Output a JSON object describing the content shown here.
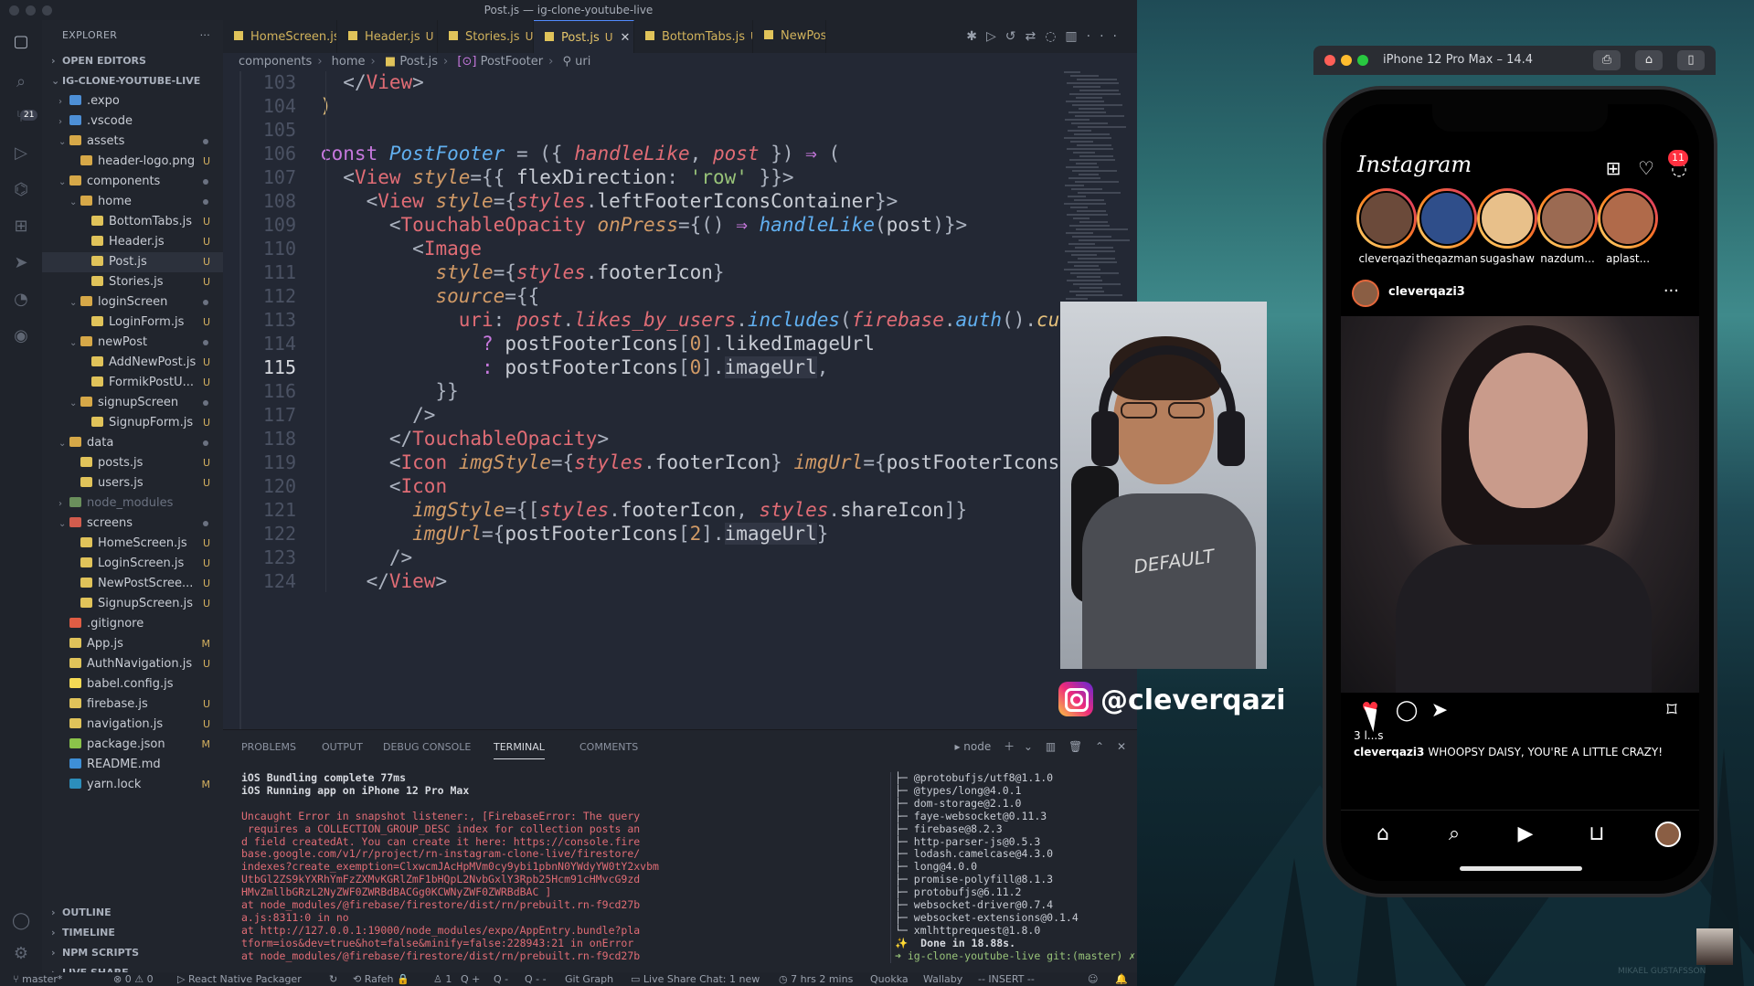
{
  "window": {
    "title": "Post.js — ig-clone-youtube-live"
  },
  "activity_bar": {
    "scm_badge": "21"
  },
  "explorer": {
    "header": "EXPLORER",
    "open_editors": "OPEN EDITORS",
    "project": "IG-CLONE-YOUTUBE-LIVE",
    "items": [
      {
        "label": ".expo",
        "indent": 1,
        "kind": "folder-closed",
        "status": ""
      },
      {
        "label": ".vscode",
        "indent": 1,
        "kind": "folder-closed",
        "status": ""
      },
      {
        "label": "assets",
        "indent": 1,
        "kind": "folder-open",
        "status": "dot"
      },
      {
        "label": "header-logo.png",
        "indent": 2,
        "kind": "file",
        "status": "U"
      },
      {
        "label": "components",
        "indent": 1,
        "kind": "folder-open",
        "status": "dot"
      },
      {
        "label": "home",
        "indent": 2,
        "kind": "folder-open",
        "status": "dot"
      },
      {
        "label": "BottomTabs.js",
        "indent": 3,
        "kind": "js",
        "status": "U"
      },
      {
        "label": "Header.js",
        "indent": 3,
        "kind": "js",
        "status": "U"
      },
      {
        "label": "Post.js",
        "indent": 3,
        "kind": "js",
        "status": "U",
        "selected": true
      },
      {
        "label": "Stories.js",
        "indent": 3,
        "kind": "js",
        "status": "U"
      },
      {
        "label": "loginScreen",
        "indent": 2,
        "kind": "folder-open",
        "status": "dot"
      },
      {
        "label": "LoginForm.js",
        "indent": 3,
        "kind": "js",
        "status": "U"
      },
      {
        "label": "newPost",
        "indent": 2,
        "kind": "folder-open",
        "status": "dot"
      },
      {
        "label": "AddNewPost.js",
        "indent": 3,
        "kind": "js",
        "status": "U"
      },
      {
        "label": "FormikPostU...",
        "indent": 3,
        "kind": "js",
        "status": "U"
      },
      {
        "label": "signupScreen",
        "indent": 2,
        "kind": "folder-open",
        "status": "dot"
      },
      {
        "label": "SignupForm.js",
        "indent": 3,
        "kind": "js",
        "status": "U"
      },
      {
        "label": "data",
        "indent": 1,
        "kind": "folder-open",
        "status": "dot"
      },
      {
        "label": "posts.js",
        "indent": 2,
        "kind": "js",
        "status": "U"
      },
      {
        "label": "users.js",
        "indent": 2,
        "kind": "js",
        "status": "U"
      },
      {
        "label": "node_modules",
        "indent": 1,
        "kind": "folder-muted",
        "status": ""
      },
      {
        "label": "screens",
        "indent": 1,
        "kind": "folder-open-red",
        "status": "dot"
      },
      {
        "label": "HomeScreen.js",
        "indent": 2,
        "kind": "js",
        "status": "U"
      },
      {
        "label": "LoginScreen.js",
        "indent": 2,
        "kind": "js",
        "status": "U"
      },
      {
        "label": "NewPostScree...",
        "indent": 2,
        "kind": "js",
        "status": "U"
      },
      {
        "label": "SignupScreen.js",
        "indent": 2,
        "kind": "js",
        "status": "U"
      },
      {
        "label": ".gitignore",
        "indent": 1,
        "kind": "git",
        "status": ""
      },
      {
        "label": "App.js",
        "indent": 1,
        "kind": "js",
        "status": "M"
      },
      {
        "label": "AuthNavigation.js",
        "indent": 1,
        "kind": "js",
        "status": "U"
      },
      {
        "label": "babel.config.js",
        "indent": 1,
        "kind": "babel",
        "status": ""
      },
      {
        "label": "firebase.js",
        "indent": 1,
        "kind": "js",
        "status": "U"
      },
      {
        "label": "navigation.js",
        "indent": 1,
        "kind": "js",
        "status": "U"
      },
      {
        "label": "package.json",
        "indent": 1,
        "kind": "json",
        "status": "M"
      },
      {
        "label": "README.md",
        "indent": 1,
        "kind": "info",
        "status": ""
      },
      {
        "label": "yarn.lock",
        "indent": 1,
        "kind": "yarn",
        "status": "M"
      }
    ],
    "bottom_sections": [
      "OUTLINE",
      "TIMELINE",
      "NPM SCRIPTS",
      "LIVE SHARE"
    ]
  },
  "tabs": [
    {
      "label": "HomeScreen.js",
      "status": "U"
    },
    {
      "label": "Header.js",
      "status": "U"
    },
    {
      "label": "Stories.js",
      "status": "U"
    },
    {
      "label": "Post.js",
      "status": "U",
      "active": true
    },
    {
      "label": "BottomTabs.js",
      "status": "U"
    },
    {
      "label": "NewPostS",
      "status": ""
    }
  ],
  "breadcrumb": [
    "components",
    "home",
    "Post.js",
    "PostFooter",
    "uri"
  ],
  "editor": {
    "current_line": "115",
    "line_numbers": [
      "103",
      "104",
      "105",
      "106",
      "107",
      "108",
      "109",
      "110",
      "111",
      "112",
      "113",
      "114",
      "115",
      "116",
      "117",
      "118",
      "119",
      "120",
      "121",
      "122",
      "123",
      "124"
    ]
  },
  "panel": {
    "tabs": [
      "PROBLEMS",
      "OUTPUT",
      "DEBUG CONSOLE",
      "TERMINAL",
      "COMMENTS"
    ],
    "active_tab": "TERMINAL",
    "shell": "node",
    "terminal_left": [
      {
        "text": "iOS Bundling complete 77ms",
        "style": "white"
      },
      {
        "text": "iOS Running app on iPhone 12 Pro Max",
        "style": "white"
      },
      {
        "text": "",
        "style": "plain"
      },
      {
        "text": "Uncaught Error in snapshot listener:, [FirebaseError: The query",
        "style": "red"
      },
      {
        "text": " requires a COLLECTION_GROUP_DESC index for collection posts an",
        "style": "red"
      },
      {
        "text": "d field createdAt. You can create it here: https://console.fire",
        "style": "red"
      },
      {
        "text": "base.google.com/v1/r/project/rn-instagram-clone-live/firestore/",
        "style": "red"
      },
      {
        "text": "indexes?create_exemption=ClxwcmJAcHpMVm0cy9ybi1pbnN0YWdyYW0tY2xvbm",
        "style": "red"
      },
      {
        "text": "UtbGl2ZS9kYXRhYmFzZXMvKGRlZmF1bHQpL2NvbGxlY3Rpb25Hcm91cHMvcG9zd",
        "style": "red"
      },
      {
        "text": "HMvZmllbGRzL2NyZWF0ZWRBdBACGg0KCWNyZWF0ZWRBdBAC ]",
        "style": "red"
      },
      {
        "text": "at node_modules/@firebase/firestore/dist/rn/prebuilt.rn-f9cd27b",
        "style": "red"
      },
      {
        "text": "a.js:8311:0 in no",
        "style": "red"
      },
      {
        "text": "at http://127.0.0.1:19000/node_modules/expo/AppEntry.bundle?pla",
        "style": "red"
      },
      {
        "text": "tform=ios&dev=true&hot=false&minify=false:228943:21 in onError",
        "style": "red"
      },
      {
        "text": "at node_modules/@firebase/firestore/dist/rn/prebuilt.rn-f9cd27b",
        "style": "red"
      }
    ],
    "terminal_right": [
      "├─ @protobufjs/utf8@1.1.0",
      "├─ @types/long@4.0.1",
      "├─ dom-storage@2.1.0",
      "├─ faye-websocket@0.11.3",
      "├─ firebase@8.2.3",
      "├─ http-parser-js@0.5.3",
      "├─ lodash.camelcase@4.3.0",
      "├─ long@4.0.0",
      "├─ promise-polyfill@8.1.3",
      "├─ protobufjs@6.11.2",
      "├─ websocket-driver@0.7.4",
      "├─ websocket-extensions@0.1.4",
      "└─ xmlhttprequest@1.8.0",
      "✨  Done in 18.88s."
    ],
    "prompt": "➜ ig-clone-youtube-live git:(master) ✗"
  },
  "statusbar": {
    "branch": "master*",
    "problems": "⊗ 0 ⚠ 0",
    "packager": "React Native Packager",
    "user": "Rafeh",
    "count": "1",
    "q1": "Q +",
    "q2": "Q -",
    "q3": "Q - -",
    "git_graph": "Git Graph",
    "live_share": "Live Share Chat: 1 new",
    "time": "7 hrs 2 mins",
    "quokka": "Quokka",
    "wallaby": "Wallaby",
    "mode": "-- INSERT --"
  },
  "overlay": {
    "handle": "@cleverqazi",
    "shirt_text": "DEFAULT"
  },
  "simulator": {
    "title": "iPhone 12 Pro Max – 14.4",
    "app": {
      "wordmark": "Instagram",
      "unread_badge": "11",
      "stories": [
        {
          "name": "cleverqazi",
          "color": "#6b4a3a"
        },
        {
          "name": "theqazman",
          "color": "#2f4e8a"
        },
        {
          "name": "sugashaw",
          "color": "#e8c08a"
        },
        {
          "name": "nazdum...",
          "color": "#9b6a52"
        },
        {
          "name": "aplast...",
          "color": "#b06a4a"
        }
      ],
      "post": {
        "user": "cleverqazi3",
        "likes": "3 l...s",
        "caption_user": "cleverqazi3",
        "caption_text": "WHOOPSY DAISY, YOU'RE A LITTLE CRAZY!"
      }
    }
  },
  "watermark": "MIKAEL GUSTAFSSON"
}
